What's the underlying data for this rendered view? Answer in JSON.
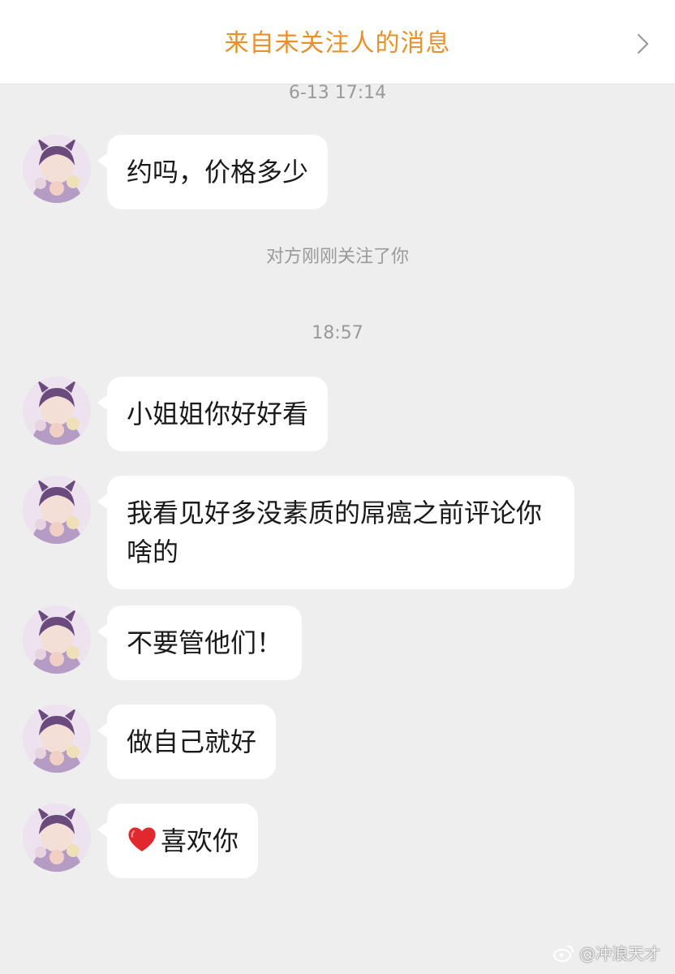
{
  "header": {
    "title": "来自未关注人的消息"
  },
  "conversation": {
    "timestamp_1": "6-13 17:14",
    "timestamp_2": "18:57",
    "system_note": "对方刚刚关注了你",
    "messages": [
      {
        "text": "约吗，价格多少"
      },
      {
        "text": "小姐姐你好好看"
      },
      {
        "text": "我看见好多没素质的屌癌之前评论你啥的"
      },
      {
        "text": "不要管他们！"
      },
      {
        "text": "做自己就好"
      },
      {
        "text": "喜欢你",
        "prefix_icon": "red-heart-emoji"
      }
    ]
  },
  "watermark": {
    "text": "@冲浪天才",
    "icon": "weibo-logo"
  },
  "colors": {
    "title_orange": "#e8902a",
    "background": "#eeeeee",
    "bubble": "#ffffff",
    "meta_gray": "#9a9a9a"
  }
}
